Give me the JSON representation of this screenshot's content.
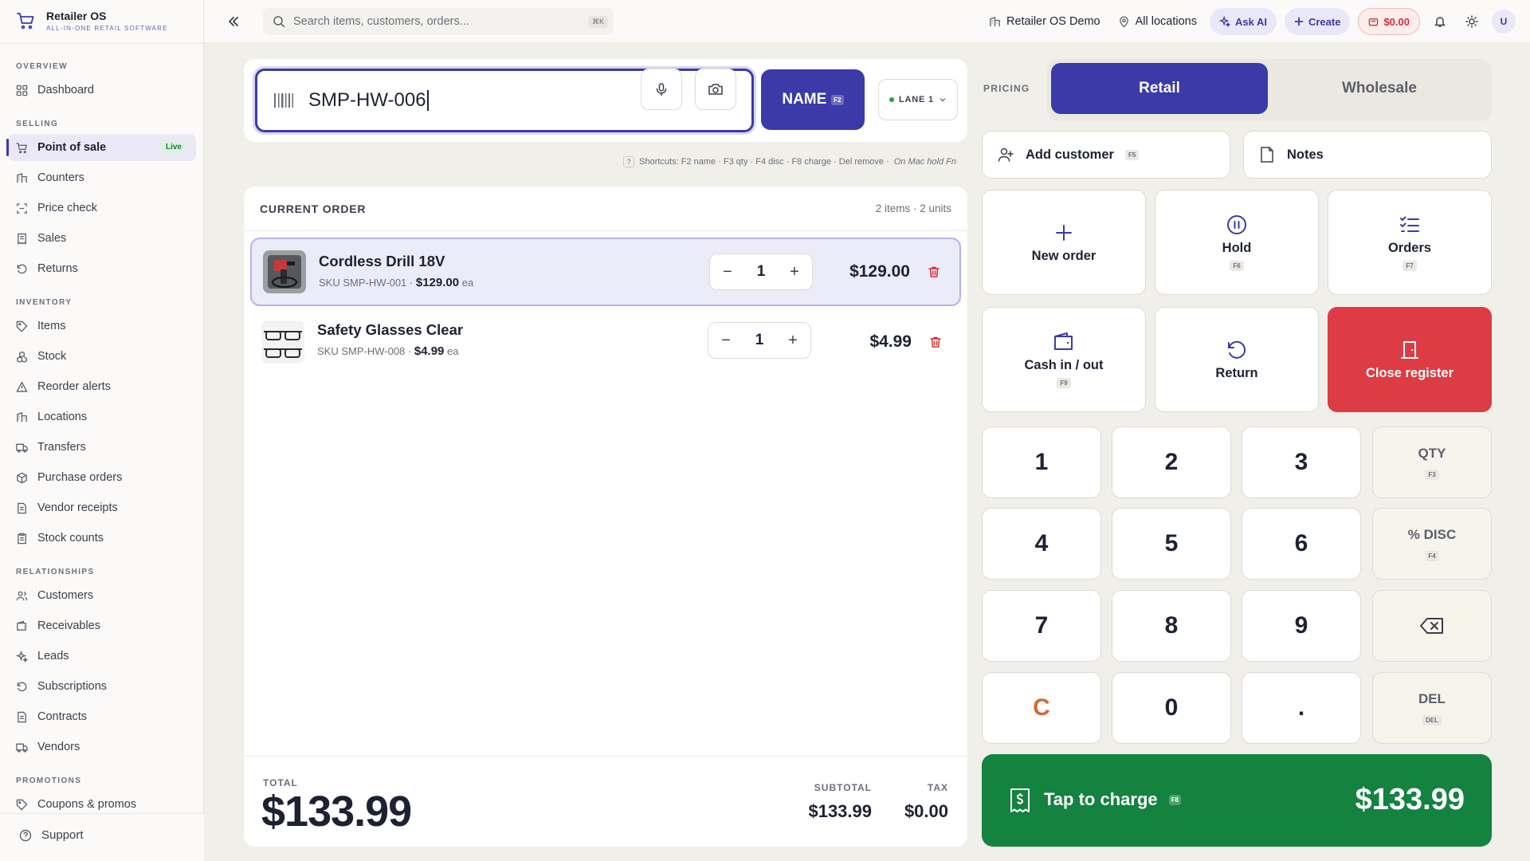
{
  "brand": {
    "name": "Retailer OS",
    "tagline": "ALL-IN-ONE RETAIL SOFTWARE"
  },
  "sidebar": {
    "sections": [
      {
        "title": "OVERVIEW",
        "items": [
          {
            "label": "Dashboard",
            "icon": "grid-icon"
          }
        ]
      },
      {
        "title": "SELLING",
        "items": [
          {
            "label": "Point of sale",
            "icon": "cart-icon",
            "active": true,
            "badge": "Live"
          },
          {
            "label": "Counters",
            "icon": "building-icon"
          },
          {
            "label": "Price check",
            "icon": "scan-icon"
          },
          {
            "label": "Sales",
            "icon": "receipt-icon"
          },
          {
            "label": "Returns",
            "icon": "return-icon"
          }
        ]
      },
      {
        "title": "INVENTORY",
        "items": [
          {
            "label": "Items",
            "icon": "tag-icon"
          },
          {
            "label": "Stock",
            "icon": "boxes-icon"
          },
          {
            "label": "Reorder alerts",
            "icon": "alert-icon"
          },
          {
            "label": "Locations",
            "icon": "building-icon"
          },
          {
            "label": "Transfers",
            "icon": "truck-icon"
          },
          {
            "label": "Purchase orders",
            "icon": "package-icon"
          },
          {
            "label": "Vendor receipts",
            "icon": "doc-icon"
          },
          {
            "label": "Stock counts",
            "icon": "clipboard-icon"
          }
        ]
      },
      {
        "title": "RELATIONSHIPS",
        "items": [
          {
            "label": "Customers",
            "icon": "users-icon"
          },
          {
            "label": "Receivables",
            "icon": "wallet-icon"
          },
          {
            "label": "Leads",
            "icon": "sparkle-icon"
          },
          {
            "label": "Subscriptions",
            "icon": "refresh-icon"
          },
          {
            "label": "Contracts",
            "icon": "doc-icon"
          },
          {
            "label": "Vendors",
            "icon": "truck-icon"
          }
        ]
      },
      {
        "title": "PROMOTIONS",
        "items": [
          {
            "label": "Coupons & promos",
            "icon": "tag-icon"
          }
        ]
      }
    ],
    "footer": {
      "support_label": "Support"
    }
  },
  "topbar": {
    "search_placeholder": "Search items, customers, orders...",
    "search_shortcut": "⌘K",
    "store": "Retailer OS Demo",
    "location": "All locations",
    "ask_ai": "Ask AI",
    "create": "Create",
    "cash": "$0.00",
    "avatar": "U"
  },
  "scan": {
    "value": "SMP-HW-006",
    "name_button": "NAME",
    "name_key": "F2",
    "lane": "LANE 1",
    "shortcuts": "Shortcuts: F2 name · F3 qty · F4 disc · F8 charge · Del remove ·",
    "mac_hint": "On Mac hold Fn"
  },
  "order": {
    "title": "CURRENT ORDER",
    "count": "2 items · 2 units",
    "lines": [
      {
        "name": "Cordless Drill 18V",
        "sku": "SKU SMP-HW-001 ·",
        "unit_price": "$129.00",
        "unit": "ea",
        "qty": "1",
        "total": "$129.00",
        "selected": true
      },
      {
        "name": "Safety Glasses Clear",
        "sku": "SKU SMP-HW-008 ·",
        "unit_price": "$4.99",
        "unit": "ea",
        "qty": "1",
        "total": "$4.99",
        "selected": false
      }
    ],
    "total_label": "TOTAL",
    "total": "$133.99",
    "subtotal_label": "SUBTOTAL",
    "subtotal": "$133.99",
    "tax_label": "TAX",
    "tax": "$0.00"
  },
  "pricing": {
    "label": "PRICING",
    "retail": "Retail",
    "wholesale": "Wholesale",
    "selected": "Retail"
  },
  "actions": {
    "add_customer": "Add customer",
    "add_customer_key": "F5",
    "notes": "Notes",
    "new_order": "New order",
    "hold": "Hold",
    "hold_key": "F6",
    "orders": "Orders",
    "orders_key": "F7",
    "cash_in_out": "Cash in / out",
    "cash_key": "F9",
    "return": "Return",
    "close_register": "Close register"
  },
  "keypad": {
    "digits": [
      "1",
      "2",
      "3",
      "4",
      "5",
      "6",
      "7",
      "8",
      "9",
      "C",
      "0",
      "."
    ],
    "qty": "QTY",
    "qty_key": "F3",
    "disc": "% DISC",
    "disc_key": "F4",
    "del": "DEL",
    "del_key": "DEL"
  },
  "charge": {
    "label": "Tap to charge",
    "key": "F8",
    "amount": "$133.99"
  },
  "colors": {
    "accent": "#3b3aa8",
    "charge": "#13833f",
    "danger": "#dd3c44",
    "clear_key": "#d26a36"
  }
}
